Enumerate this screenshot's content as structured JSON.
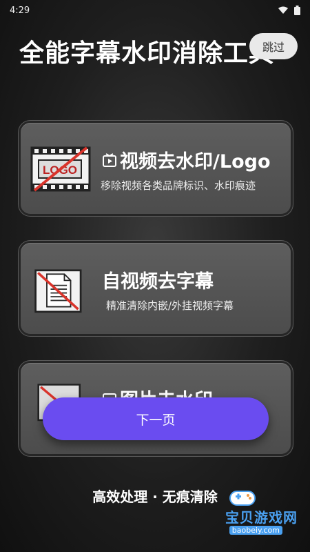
{
  "status": {
    "time": "4:29"
  },
  "title": "全能字幕水印消除工具",
  "skip_label": "跳过",
  "cards": [
    {
      "title": "视频去水印/Logo",
      "subtitle": "移除视频各类品牌标识、水印痕迹",
      "icon_text": "LOGO"
    },
    {
      "title": "自视频去字幕",
      "subtitle": "精准清除内嵌/外挂视频字幕"
    },
    {
      "title": "图片去水印"
    }
  ],
  "next_label": "下一页",
  "footer_text": "高效处理 · 无痕清除",
  "watermark": {
    "text": "宝贝游戏网",
    "url": "baobeiy.com"
  },
  "colors": {
    "accent": "#6a4cf0",
    "card": "#555555",
    "slash": "#d9342b"
  }
}
